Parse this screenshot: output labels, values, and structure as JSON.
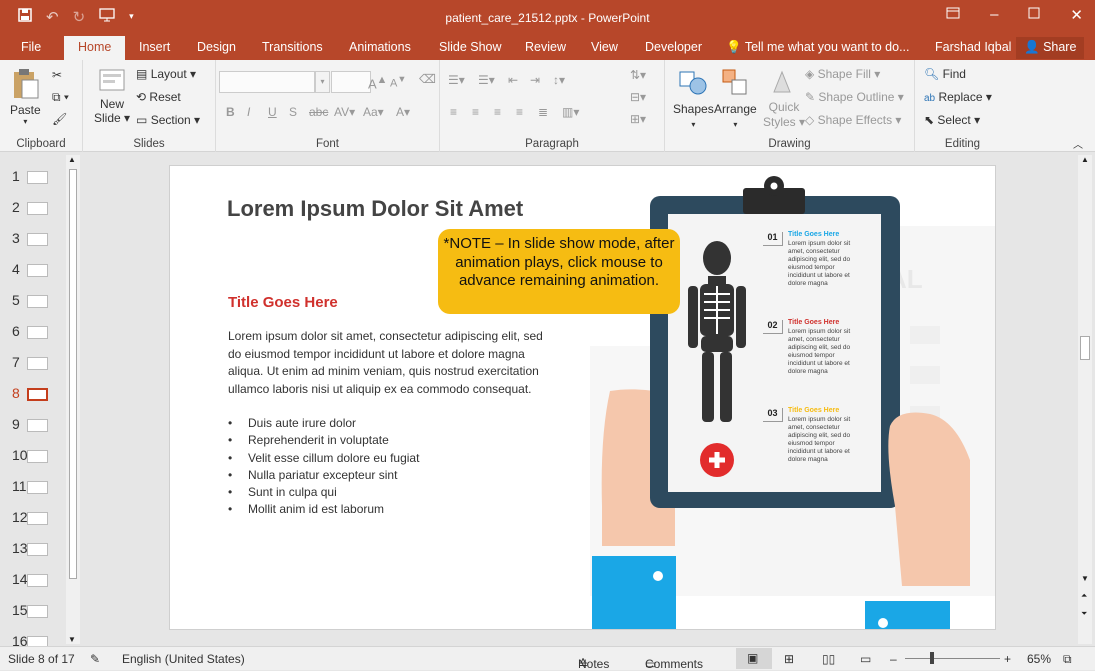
{
  "window": {
    "title": "patient_care_21512.pptx - PowerPoint"
  },
  "tabs": [
    "File",
    "Home",
    "Insert",
    "Design",
    "Transitions",
    "Animations",
    "Slide Show",
    "Review",
    "View",
    "Developer"
  ],
  "tell_me": "Tell me what you want to do...",
  "user": "Farshad Iqbal",
  "share": "Share",
  "ribbon": {
    "clipboard": {
      "label": "Clipboard",
      "paste": "Paste"
    },
    "slides": {
      "label": "Slides",
      "new_slide_1": "New",
      "new_slide_2": "Slide",
      "layout": "Layout",
      "reset": "Reset",
      "section": "Section"
    },
    "font": {
      "label": "Font"
    },
    "paragraph": {
      "label": "Paragraph"
    },
    "drawing": {
      "label": "Drawing",
      "shapes": "Shapes",
      "arrange": "Arrange",
      "quick_styles_1": "Quick",
      "quick_styles_2": "Styles",
      "shape_fill": "Shape Fill",
      "shape_outline": "Shape Outline",
      "shape_effects": "Shape Effects"
    },
    "editing": {
      "label": "Editing",
      "find": "Find",
      "replace": "Replace",
      "select": "Select"
    }
  },
  "thumbnails": [
    "1",
    "2",
    "3",
    "4",
    "5",
    "6",
    "7",
    "8",
    "9",
    "10",
    "11",
    "12",
    "13",
    "14",
    "15",
    "16"
  ],
  "selected_slide": "8",
  "slide": {
    "title": "Lorem Ipsum Dolor Sit Amet",
    "subtitle": "Title Goes Here",
    "paragraph": "Lorem ipsum dolor sit amet, consectetur adipiscing elit, sed do eiusmod tempor incididunt ut labore et dolore magna aliqua. Ut enim ad minim veniam, quis nostrud exercitation ullamco laboris nisi ut aliquip ex ea commodo consequat.",
    "bullets": [
      "Duis aute irure dolor",
      "Reprehenderit in voluptate",
      "Velit esse cillum dolore eu fugiat",
      "Nulla pariatur excepteur sint",
      "Sunt in culpa qui",
      "Mollit anim id est laborum"
    ],
    "note": "*NOTE – In slide show mode, after animation plays, click mouse to advance remaining animation.",
    "clipboard_items": [
      {
        "num": "01",
        "title": "Title Goes Here",
        "title_color": "#1aa7e6",
        "text": "Lorem ipsum dolor sit amet, consectetur adipiscing elit, sed do eiusmod tempor incididunt ut labore et dolore magna"
      },
      {
        "num": "02",
        "title": "Title Goes Here",
        "title_color": "#d0312d",
        "text": "Lorem ipsum dolor sit amet, consectetur adipiscing elit, sed do eiusmod tempor incididunt ut labore et dolore magna"
      },
      {
        "num": "03",
        "title": "Title Goes Here",
        "title_color": "#f6bc12",
        "text": "Lorem ipsum dolor sit amet, consectetur adipiscing elit, sed do eiusmod tempor incididunt ut labore et dolore magna"
      }
    ]
  },
  "status": {
    "slide": "Slide 8 of 17",
    "language": "English (United States)",
    "notes": "Notes",
    "comments": "Comments",
    "zoom": "65%"
  },
  "colors": {
    "accent": "#b7472a",
    "note": "#f6bc12",
    "clipboard": "#2d4a5e",
    "sleeve": "#1aa7e6"
  }
}
